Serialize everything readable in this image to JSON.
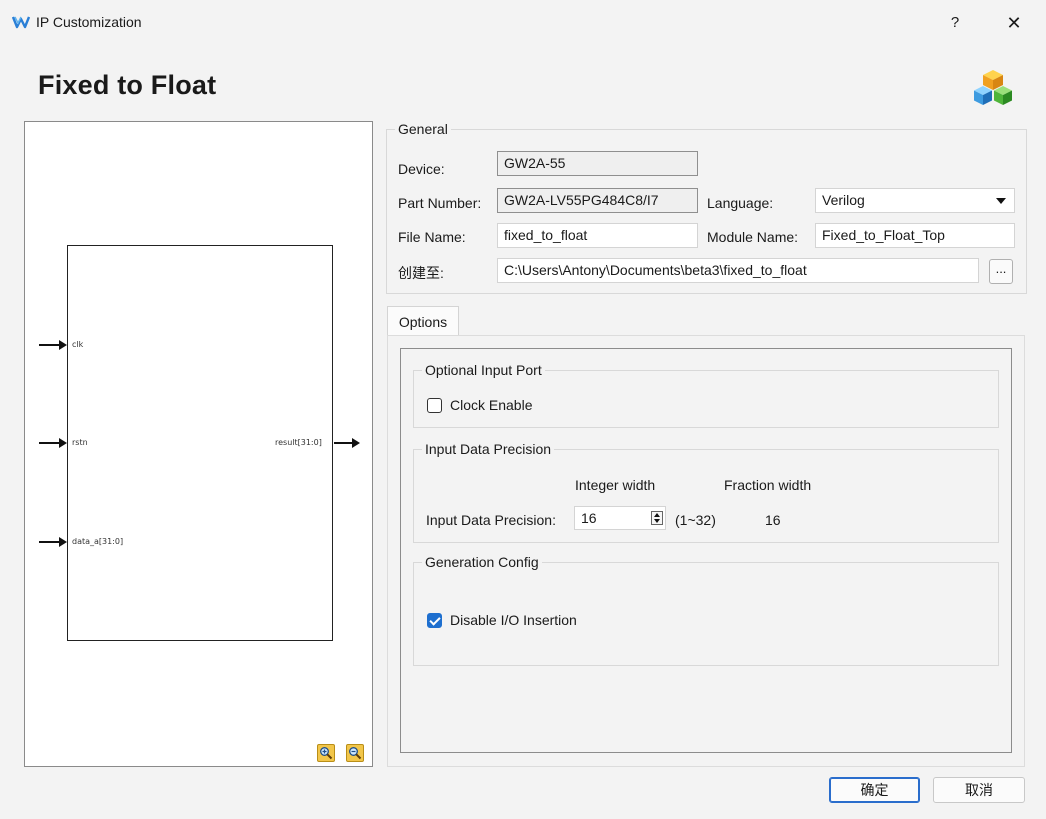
{
  "window": {
    "title": "IP Customization",
    "help": "?",
    "close": "✕"
  },
  "heading": "Fixed to Float",
  "diagram": {
    "ports_in": [
      "clk",
      "rstn",
      "data_a[31:0]"
    ],
    "ports_out": [
      "result[31:0]"
    ]
  },
  "general": {
    "title": "General",
    "device_label": "Device:",
    "device_value": "GW2A-55",
    "part_label": "Part Number:",
    "part_value": "GW2A-LV55PG484C8/I7",
    "language_label": "Language:",
    "language_value": "Verilog",
    "file_label": "File Name:",
    "file_value": "fixed_to_float",
    "module_label": "Module Name:",
    "module_value": "Fixed_to_Float_Top",
    "create_label": "创建至:",
    "create_value": "C:\\Users\\Antony\\Documents\\beta3\\fixed_to_float",
    "browse_label": "..."
  },
  "tabs": [
    {
      "label": "Options"
    }
  ],
  "options": {
    "optional_input": {
      "title": "Optional Input Port",
      "clock_enable_label": "Clock Enable",
      "clock_enable_checked": false
    },
    "precision": {
      "title": "Input Data Precision",
      "integer_header": "Integer width",
      "fraction_header": "Fraction width",
      "row_label": "Input Data Precision:",
      "integer_value": "16",
      "range": "(1~32)",
      "fraction_value": "16"
    },
    "generation": {
      "title": "Generation Config",
      "disable_io_label": "Disable I/O Insertion",
      "disable_io_checked": true
    }
  },
  "buttons": {
    "ok": "确定",
    "cancel": "取消"
  }
}
